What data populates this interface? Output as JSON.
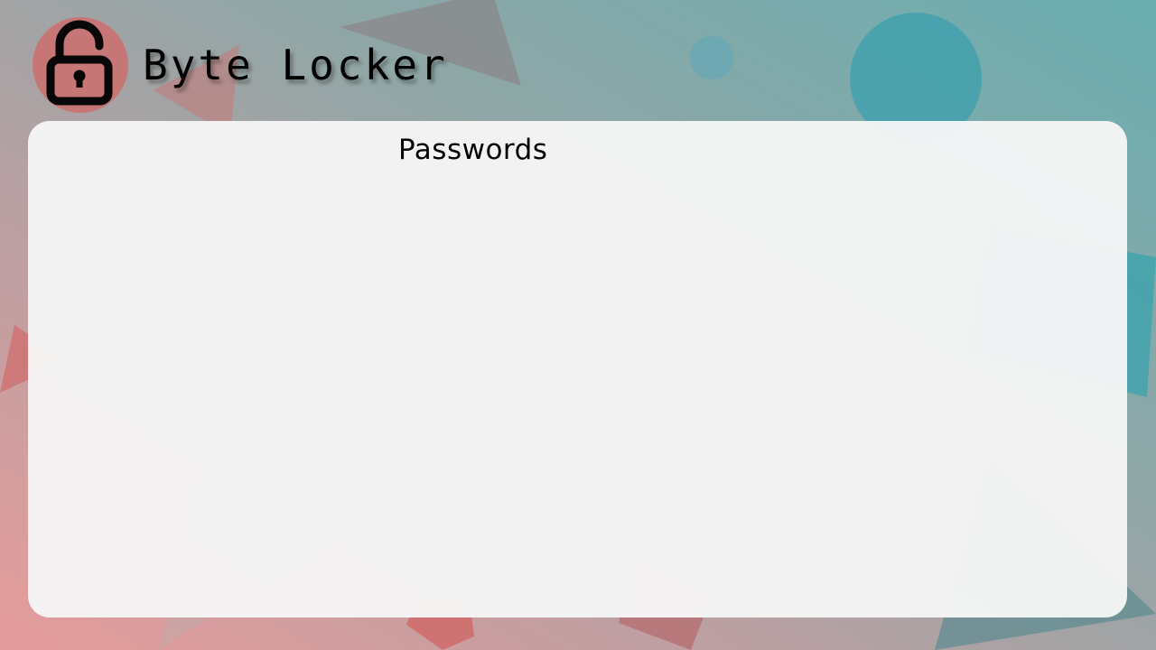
{
  "app": {
    "title": "Byte Locker",
    "logo_icon": "unlocked-padlock-icon"
  },
  "main": {
    "title": "Passwords",
    "items": []
  },
  "colors": {
    "background_gradient_start": "#e69b9b",
    "background_gradient_end": "#6aaeb0",
    "logo_circle": "#c97474",
    "panel_background": "#f5f5f5",
    "text": "#000000"
  }
}
